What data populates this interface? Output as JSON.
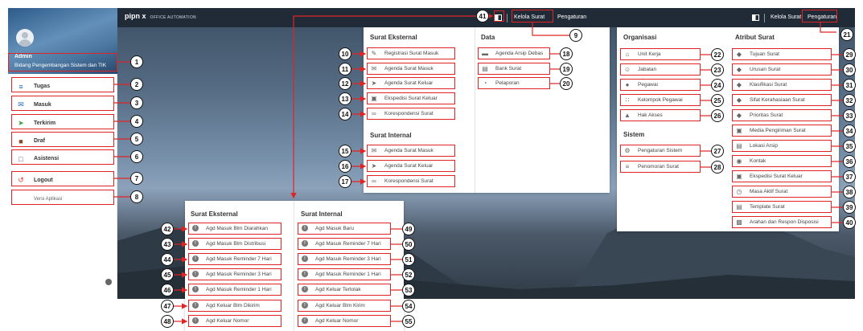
{
  "logo": {
    "main": "pipn x",
    "sub": "OFFICE AUTOMATION"
  },
  "topbar": {
    "kelola_surat": "Kelola Surat",
    "pengaturan": "Pengaturan"
  },
  "profile": {
    "name": "Admin",
    "unit": "Bidang Pengembangan Sistem dan TIK"
  },
  "sidebar": {
    "items": [
      {
        "label": "Tugas",
        "icon": "list-icon"
      },
      {
        "label": "Masuk",
        "icon": "mail-icon"
      },
      {
        "label": "Terkirim",
        "icon": "send-icon"
      },
      {
        "label": "Draf",
        "icon": "draft-icon"
      },
      {
        "label": "Asistensi",
        "icon": "monitor-icon"
      },
      {
        "label": "Logout",
        "icon": "logout-icon"
      },
      {
        "label": "Versi Aplikasi",
        "icon": ""
      }
    ]
  },
  "kelola_panel": {
    "surat_eksternal_title": "Surat Eksternal",
    "surat_eksternal": [
      "Registrasi Surat Masuk",
      "Agenda Surat Masuk",
      "Agenda Surat Keluar",
      "Ekspedisi Surat Keluar",
      "Korespondensi Surat"
    ],
    "surat_internal_title": "Surat Internal",
    "surat_internal": [
      "Agenda Surat Masuk",
      "Agenda Surat Keluar",
      "Korespondensi Surat"
    ],
    "data_title": "Data",
    "data": [
      "Agenda Arsip Debas",
      "Bank Surat",
      "Pelaporan"
    ]
  },
  "pengaturan_panel": {
    "organisasi_title": "Organisasi",
    "organisasi": [
      "Unit Kerja",
      "Jabatan",
      "Pegawai",
      "Kelompok Pegawai",
      "Hak Akses"
    ],
    "sistem_title": "Sistem",
    "sistem": [
      "Pengaturan Sistem",
      "Penomoran Surat"
    ],
    "atribut_title": "Atribut Surat",
    "atribut": [
      "Tujuan Surat",
      "Urusan Surat",
      "Klasifikasi Surat",
      "Sifat Kerahasiaan Surat",
      "Prioritas Surat",
      "Media Pengiriman Surat",
      "Lokasi Arsip",
      "Kontak",
      "Ekspedisi Surat Keluar",
      "Masa Aktif Surat",
      "Template Surat",
      "Arahan dan Respon Disposisi"
    ]
  },
  "notif_panel": {
    "eksternal_title": "Surat Eksternal",
    "eksternal": [
      "Agd Masuk Blm Diarahkan",
      "Agd Masuk Blm Distribusi",
      "Agd Masuk Reminder 7 Hari",
      "Agd Masuk Reminder 3 Hari",
      "Agd Masuk Reminder 1 Hari",
      "Agd Keluar Blm Dikirim",
      "Agd Keluar Nomor"
    ],
    "internal_title": "Surat Internal",
    "internal": [
      "Agd Masuk Baru",
      "Agd Masuk Reminder 7 Hari",
      "Agd Masuk Reminder 3 Hari",
      "Agd Masuk Reminder 1 Hari",
      "Agd Keluar Tertolak",
      "Agd Keluar Blm Kirim",
      "Agd Keluar Nomor"
    ]
  },
  "badges": [
    "1",
    "2",
    "3",
    "4",
    "5",
    "6",
    "7",
    "8",
    "9",
    "10",
    "11",
    "12",
    "13",
    "14",
    "15",
    "16",
    "17",
    "18",
    "19",
    "20",
    "21",
    "22",
    "23",
    "24",
    "25",
    "26",
    "27",
    "28",
    "29",
    "30",
    "31",
    "32",
    "33",
    "34",
    "35",
    "36",
    "37",
    "38",
    "39",
    "40",
    "41",
    "42",
    "43",
    "44",
    "45",
    "46",
    "47",
    "48",
    "49",
    "50",
    "51",
    "52",
    "53",
    "54",
    "55"
  ],
  "colors": {
    "highlight": "#e02424",
    "topbar": "#1e2834",
    "icon_red": "#e53935",
    "icon_blue": "#2565b8",
    "icon_green": "#3aa33a"
  }
}
